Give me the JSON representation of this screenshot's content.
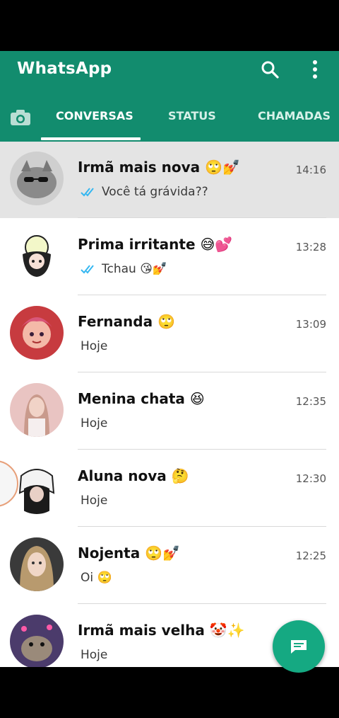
{
  "app": {
    "title": "WhatsApp"
  },
  "tabs": [
    {
      "label": "CONVERSAS",
      "active": true
    },
    {
      "label": "STATUS"
    },
    {
      "label": "CHAMADAS"
    }
  ],
  "chats": [
    {
      "name": "Irmã mais nova 🙄💅",
      "time": "14:16",
      "preview": "Você tá grávida??",
      "read_ticks": true,
      "selected": true
    },
    {
      "name": "Prima irritante 😅💕",
      "time": "13:28",
      "preview": "Tchau 😘💅",
      "read_ticks": true
    },
    {
      "name": "Fernanda 🙄",
      "time": "13:09",
      "preview": "Hoje"
    },
    {
      "name": "Menina chata 😆",
      "time": "12:35",
      "preview": "Hoje"
    },
    {
      "name": "Aluna nova 🤔",
      "time": "12:30",
      "preview": "Hoje"
    },
    {
      "name": "Nojenta 🙄💅",
      "time": "12:25",
      "preview": "Oi 🙄"
    },
    {
      "name": "Irmã mais velha 🤡✨",
      "time": "",
      "preview": "Hoje"
    }
  ],
  "colors": {
    "header": "#128c6e",
    "fab": "#15a982",
    "read_ticks": "#34b7f1"
  },
  "icons": {
    "search": "search-icon",
    "menu": "more-vert-icon",
    "camera": "camera-icon",
    "fab": "new-chat-icon"
  }
}
